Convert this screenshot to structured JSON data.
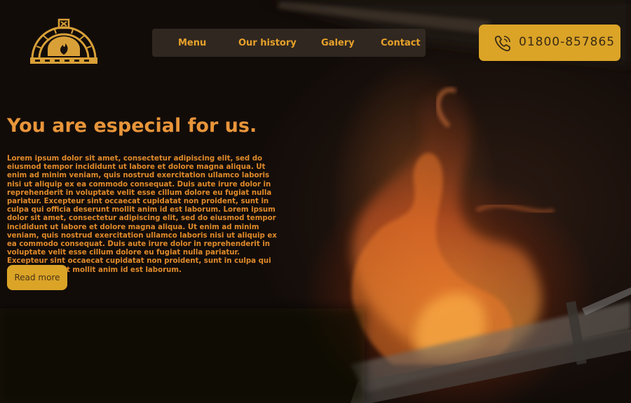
{
  "colors": {
    "accent": "#dba427",
    "nav_text": "#e8a22a",
    "headline": "#e8953a",
    "body_text": "#e08a2a",
    "nav_background": "#372d26"
  },
  "logo": {
    "icon": "pizza-oven-icon"
  },
  "nav": {
    "items": [
      {
        "label": "Menu"
      },
      {
        "label": "Our history"
      },
      {
        "label": "Galery"
      },
      {
        "label": "Contact"
      }
    ]
  },
  "phone": {
    "icon": "phone-icon",
    "number": "01800-857865"
  },
  "hero": {
    "headline": "You are especial for us.",
    "body": "Lorem ipsum dolor sit amet, consectetur adipiscing elit, sed do eiusmod tempor incididunt ut labore et dolore magna aliqua. Ut enim ad minim veniam, quis nostrud exercitation ullamco laboris nisi ut aliquip ex ea commodo consequat. Duis aute irure dolor in reprehenderit in voluptate velit esse cillum dolore eu fugiat nulla pariatur. Excepteur sint occaecat cupidatat non proident, sunt in culpa qui officia deserunt mollit anim id est laborum. Lorem ipsum dolor sit amet, consectetur adipiscing elit, sed do eiusmod tempor incididunt ut labore et dolore magna aliqua. Ut enim ad minim veniam, quis nostrud exercitation ullamco laboris nisi ut aliquip ex ea commodo consequat. Duis aute irure dolor in reprehenderit in voluptate velit esse cillum dolore eu fugiat nulla pariatur. Excepteur sint occaecat cupidatat non proident, sunt in culpa qui officia deserunt mollit anim id est laborum.",
    "button_label": "Read more"
  }
}
